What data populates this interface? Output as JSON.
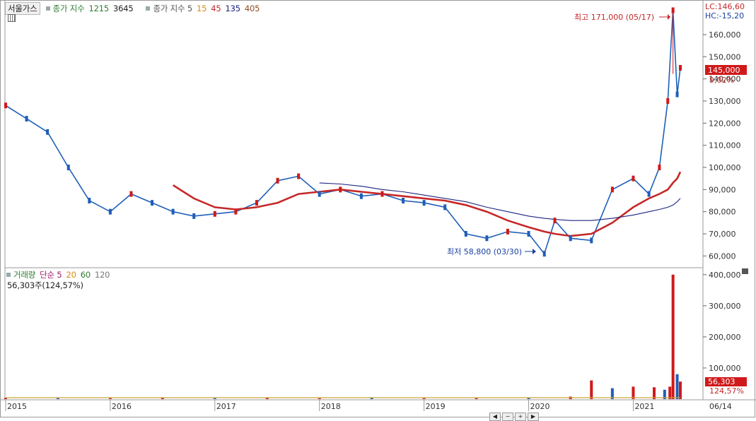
{
  "top_legend": {
    "symbol": "서울가스",
    "items": [
      {
        "text": "종가 지수",
        "color": "#2e7d32"
      },
      {
        "text": "1215",
        "color": "#2e7d32"
      },
      {
        "text": "3645",
        "color": "#222222"
      }
    ],
    "ma_label": "종가 지수 5",
    "ma_items": [
      {
        "text": "15",
        "color": "#d98b17"
      },
      {
        "text": "45",
        "color": "#c62828"
      },
      {
        "text": "135",
        "color": "#1a237e"
      },
      {
        "text": "405",
        "color": "#8d4a1e"
      }
    ]
  },
  "right_info": {
    "lc": "LC:146,60",
    "hc": "HC:-15,20",
    "price_badge": "145,000",
    "change_pct": "9,02%"
  },
  "annotations": {
    "high": "최고 171,000 (05/17)",
    "low": "최저 58,800 (03/30)"
  },
  "volume_legend": {
    "label": "거래량",
    "ma_label": "단순 5",
    "ma_items": [
      {
        "text": "20",
        "color": "#d98b17"
      },
      {
        "text": "60",
        "color": "#2e7d32"
      },
      {
        "text": "120",
        "color": "#777777"
      }
    ],
    "value_line": "56,303주(124,57%)",
    "badge": "56,303",
    "badge_pct": "124,57%"
  },
  "x_axis": {
    "labels": [
      "2015",
      "2016",
      "2017",
      "2018",
      "2019",
      "2020",
      "2021",
      "06/14"
    ]
  },
  "colors": {
    "up": "#d0191a",
    "down": "#1f5fb8",
    "ma5": "#d0191a",
    "ma15": "#d98b17",
    "ma45": "#c62828",
    "ma135": "#1a237e",
    "badge_bg": "#d0191a"
  },
  "chart_data": [
    {
      "type": "line",
      "title": "서울가스",
      "yticks": [
        60000,
        70000,
        80000,
        90000,
        100000,
        110000,
        120000,
        130000,
        140000,
        150000,
        160000
      ],
      "yticklabels": [
        "60,000",
        "70,000",
        "80,000",
        "90,000",
        "100,000",
        "110,000",
        "120,000",
        "130,000",
        "140,000",
        "150,000",
        "160,000"
      ],
      "ylim": [
        55000,
        175000
      ],
      "x": [
        2015.0,
        2015.2,
        2015.4,
        2015.6,
        2015.8,
        2016.0,
        2016.2,
        2016.4,
        2016.6,
        2016.8,
        2017.0,
        2017.2,
        2017.4,
        2017.6,
        2017.8,
        2018.0,
        2018.2,
        2018.4,
        2018.6,
        2018.8,
        2019.0,
        2019.2,
        2019.4,
        2019.6,
        2019.8,
        2020.0,
        2020.15,
        2020.25,
        2020.4,
        2020.6,
        2020.8,
        2021.0,
        2021.15,
        2021.25,
        2021.33,
        2021.38,
        2021.42,
        2021.45
      ],
      "series": [
        {
          "values": [
            128000,
            122000,
            116000,
            100000,
            85000,
            80000,
            88000,
            84000,
            80000,
            78000,
            79000,
            80000,
            84000,
            94000,
            96000,
            88000,
            90000,
            87000,
            88000,
            85000,
            84000,
            82000,
            70000,
            68000,
            71000,
            70000,
            61000,
            76000,
            68000,
            67000,
            90000,
            95000,
            88000,
            100000,
            130000,
            171000,
            133000,
            145000
          ]
        },
        {
          "values": [
            null,
            null,
            null,
            null,
            null,
            null,
            null,
            null,
            92000,
            86000,
            82000,
            81000,
            82000,
            84000,
            88000,
            89000,
            90000,
            89000,
            88000,
            87000,
            86000,
            85000,
            83000,
            80000,
            76000,
            73000,
            71000,
            70000,
            69000,
            70000,
            75000,
            82000,
            86000,
            88000,
            90000,
            93000,
            95000,
            98000
          ]
        },
        {
          "values": [
            null,
            null,
            null,
            null,
            null,
            null,
            null,
            null,
            null,
            null,
            null,
            null,
            null,
            null,
            null,
            93000,
            92500,
            91500,
            90000,
            89000,
            87500,
            86000,
            84500,
            82000,
            80000,
            78000,
            77000,
            76500,
            76000,
            76000,
            77000,
            78500,
            80000,
            81000,
            82000,
            83000,
            84500,
            86000
          ]
        }
      ],
      "highlights": {
        "high": {
          "date": "05/17",
          "value": 171000
        },
        "low": {
          "date": "03/30",
          "value": 58800
        }
      }
    },
    {
      "type": "bar",
      "yticks": [
        100000,
        200000,
        300000,
        400000
      ],
      "yticklabels": [
        "100,000",
        "200,000",
        "300,000",
        "400,000"
      ],
      "ylim": [
        0,
        420000
      ],
      "x": [
        2015.0,
        2015.5,
        2016.0,
        2016.5,
        2017.0,
        2017.5,
        2018.0,
        2018.5,
        2019.0,
        2019.5,
        2020.0,
        2020.4,
        2020.6,
        2020.8,
        2021.0,
        2021.2,
        2021.3,
        2021.35,
        2021.38,
        2021.42,
        2021.45
      ],
      "values": [
        4000,
        3000,
        3000,
        4000,
        3000,
        4000,
        3000,
        4000,
        3000,
        3000,
        4000,
        8000,
        60000,
        35000,
        40000,
        38000,
        30000,
        40000,
        400000,
        80000,
        56303
      ]
    }
  ]
}
